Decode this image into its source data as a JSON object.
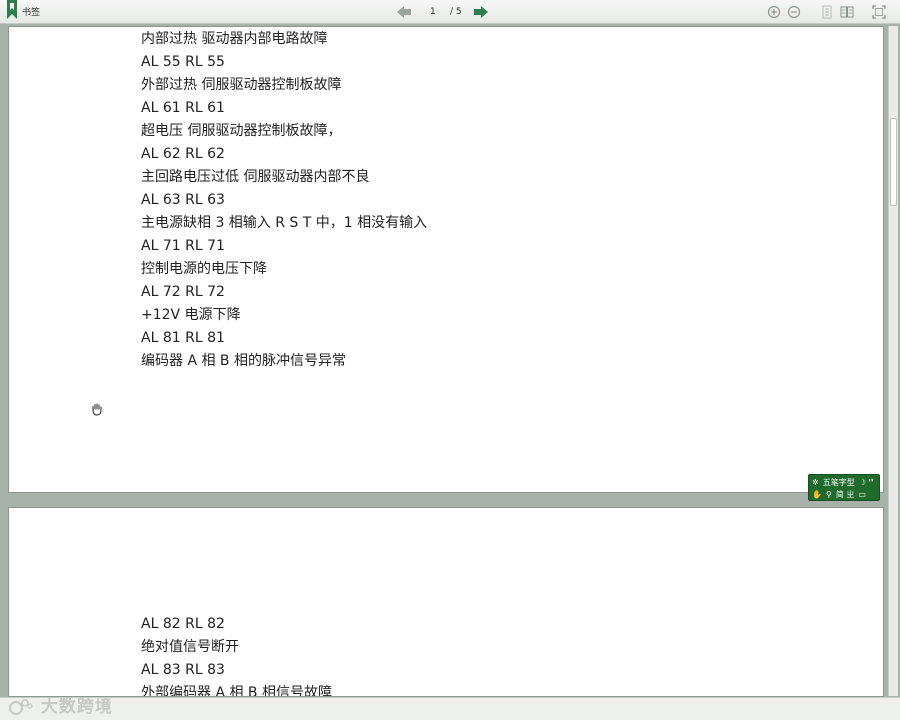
{
  "toolbar": {
    "bookmarks_label": "书签",
    "current_page": "1",
    "total_pages": "/ 5"
  },
  "page1": {
    "lines": [
      "内部过热  驱动器内部电路故障",
      "AL 55 RL 55",
      "外部过热  伺服驱动器控制板故障",
      "AL 61 RL 61",
      "超电压  伺服驱动器控制板故障，",
      "AL 62 RL 62",
      "主回路电压过低  伺服驱动器内部不良",
      "AL 63 RL 63",
      "主电源缺相  3 相输入 R S T 中，1 相没有输入",
      "AL 71 RL 71",
      "控制电源的电压下降",
      "AL 72 RL 72",
      "+12V 电源下降",
      "AL 81 RL 81",
      "编码器 A 相 B 相的脉冲信号异常"
    ]
  },
  "page2": {
    "lines": [
      "AL 82 RL 82",
      "绝对值信号断开",
      "AL 83 RL 83",
      "外部编码器 A 相 B 相信号故障"
    ]
  },
  "ime": {
    "row1": "五笔字型",
    "row2": "简 ㄓ"
  },
  "watermark": "大数跨境"
}
